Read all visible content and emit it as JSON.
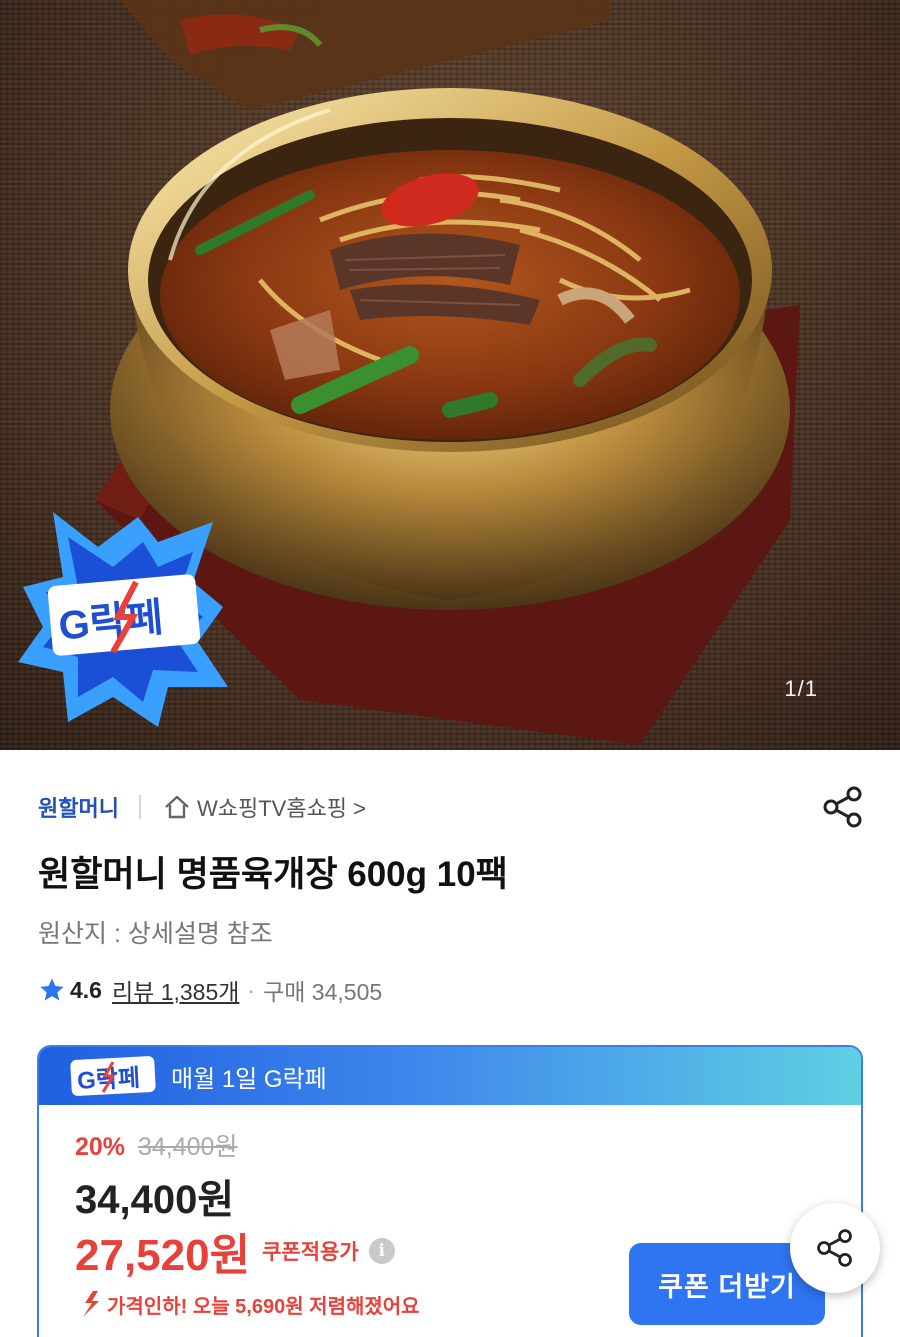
{
  "hero": {
    "pager": "1/1",
    "badge_text": "G락페"
  },
  "product": {
    "seller": "원할머니",
    "store_link": "W쇼핑TV홈쇼핑 >",
    "title": "원할머니 명품육개장 600g 10팩",
    "origin": "원산지 : 상세설명 참조",
    "rating": "4.6",
    "review_link": "리뷰 1,385개",
    "separator": "·",
    "purchase_count": "구매 34,505"
  },
  "deal": {
    "badge_text": "G락페",
    "header_label": "매월 1일 G락페",
    "discount_rate": "20%",
    "original_price": "34,400원",
    "sale_price": "34,400원",
    "coupon_price": "27,520원",
    "coupon_label": "쿠폰적용가",
    "info_icon": "i",
    "price_drop": "가격인하! 오늘 5,690원 저렴해졌어요",
    "coupon_button": "쿠폰 더받기"
  },
  "colors": {
    "accent_blue": "#2f74f0",
    "seller_blue": "#2251b8",
    "price_red": "#e8413a",
    "deal_gradient_start": "#1f5fe0",
    "deal_gradient_end": "#5fd0e3"
  },
  "icons": {
    "share": "share-icon",
    "home": "home-icon",
    "star": "star-icon",
    "info": "info-icon",
    "arrow_down": "arrow-down-icon"
  }
}
